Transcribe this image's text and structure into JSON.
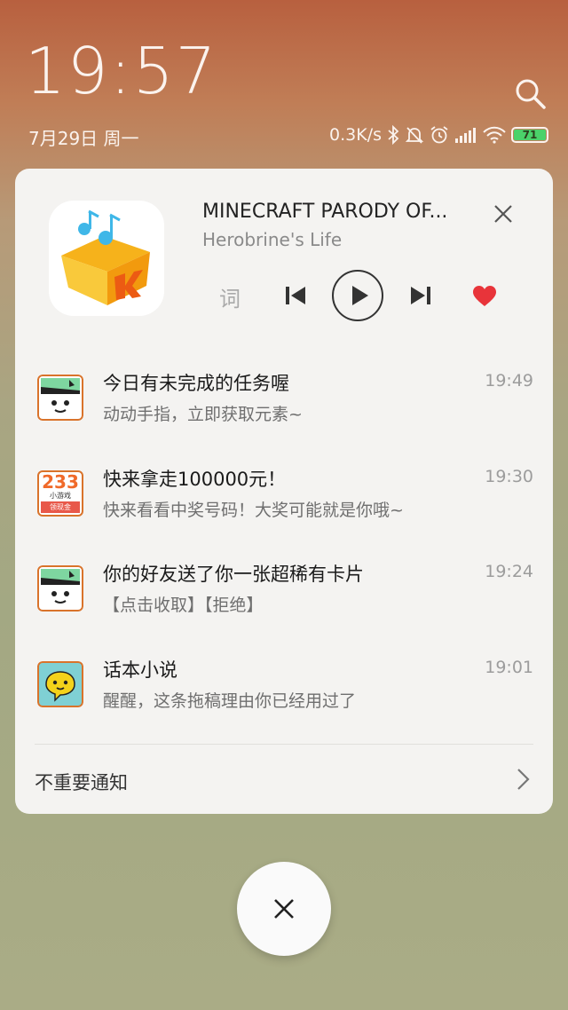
{
  "status": {
    "time": "19:57",
    "date": "7月29日 周一",
    "network_speed": "0.3K/s",
    "battery_level": "71",
    "icons": [
      "bluetooth-icon",
      "mute-bell-icon",
      "alarm-icon",
      "signal-icon",
      "wifi-icon",
      "battery-icon"
    ]
  },
  "search_icon": "search-icon",
  "media": {
    "title": "MINECRAFT PARODY OF...",
    "artist": "Herobrine's Life",
    "lyrics_label": "词",
    "liked_color": "#e8343a"
  },
  "notifications": [
    {
      "title": "今日有未完成的任务喔",
      "body": "动动手指，立即获取元素~",
      "time": "19:49",
      "icon": "game-app-icon"
    },
    {
      "title": "快来拿走100000元！",
      "body": "快来看看中奖号码！大奖可能就是你哦~",
      "time": "19:30",
      "icon": "233-game-icon",
      "icon_text_main": "233",
      "icon_text_sub": "小游戏",
      "icon_text_bottom": "领现金"
    },
    {
      "title": "你的好友送了你一张超稀有卡片",
      "body": "【点击收取】【拒绝】",
      "time": "19:24",
      "icon": "game-app-icon"
    },
    {
      "title": "话本小说",
      "body": "醒醒，这条拖稿理由你已经用过了",
      "time": "19:01",
      "icon": "novel-app-icon"
    }
  ],
  "footer": {
    "label": "不重要通知"
  }
}
